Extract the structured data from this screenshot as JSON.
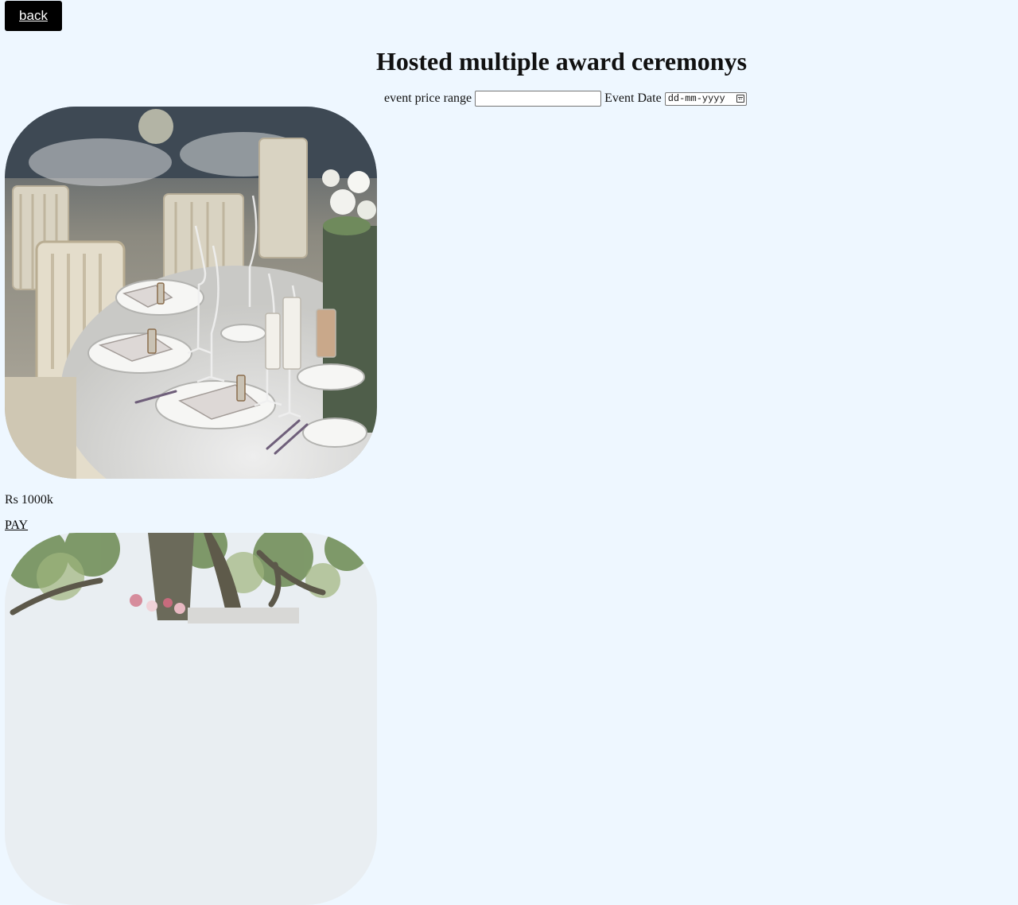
{
  "header": {
    "back_label": "back",
    "title": "Hosted multiple award ceremonys"
  },
  "filters": {
    "price_label": "event price range",
    "price_value": "",
    "date_label": "Event Date",
    "date_placeholder": "dd-mm-yyyy"
  },
  "events": [
    {
      "image": "banquet table setting with white chairs, plates, napkins and wine glasses",
      "price": "Rs 1000k",
      "pay_label": "PAY"
    },
    {
      "image": "outdoor table under a large tree with flowers"
    }
  ],
  "colors": {
    "background": "#eef7ff",
    "button_bg": "#000000",
    "button_text": "#ffffff"
  }
}
